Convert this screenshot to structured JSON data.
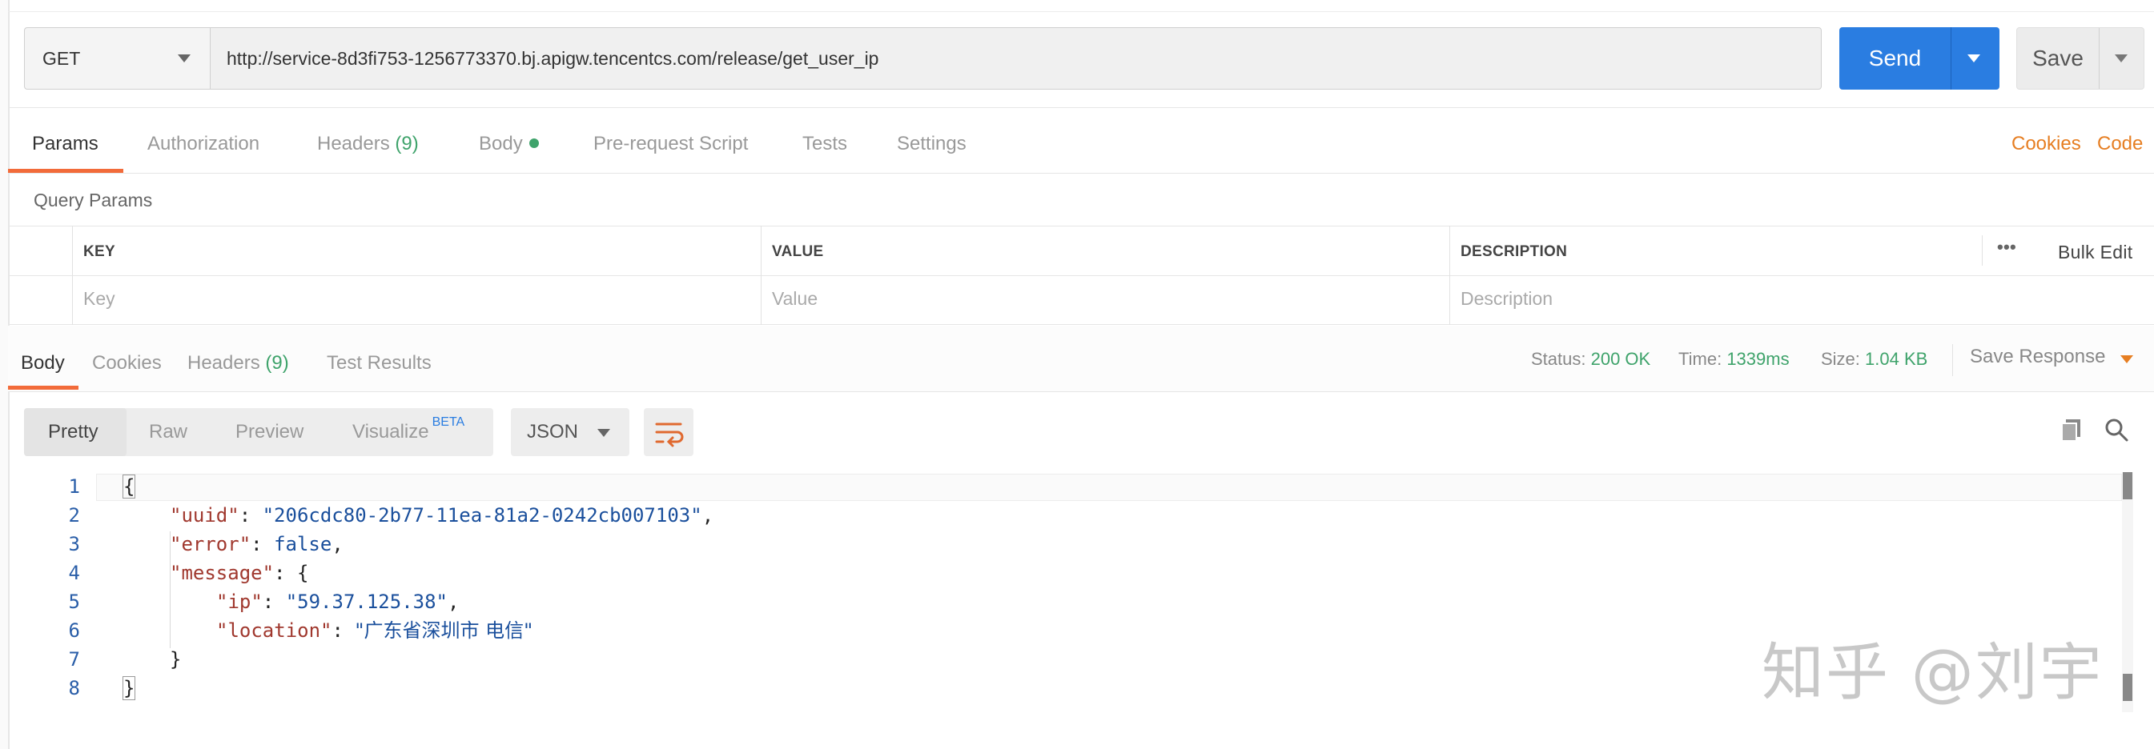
{
  "request": {
    "method": "GET",
    "url": "http://service-8d3fi753-1256773370.bj.apigw.tencentcs.com/release/get_user_ip",
    "send_label": "Send",
    "save_label": "Save"
  },
  "request_tabs": [
    {
      "label": "Params",
      "count": ""
    },
    {
      "label": "Authorization",
      "count": ""
    },
    {
      "label": "Headers",
      "count": "(9)"
    },
    {
      "label": "Body",
      "count": ""
    },
    {
      "label": "Pre-request Script",
      "count": ""
    },
    {
      "label": "Tests",
      "count": ""
    },
    {
      "label": "Settings",
      "count": ""
    }
  ],
  "right_links": {
    "cookies": "Cookies",
    "code": "Code"
  },
  "query_params": {
    "section_label": "Query Params",
    "columns": [
      "KEY",
      "VALUE",
      "DESCRIPTION"
    ],
    "placeholders": [
      "Key",
      "Value",
      "Description"
    ],
    "bulk_edit": "Bulk Edit",
    "more": "•••"
  },
  "response_tabs": [
    {
      "label": "Body",
      "count": ""
    },
    {
      "label": "Cookies",
      "count": ""
    },
    {
      "label": "Headers",
      "count": "(9)"
    },
    {
      "label": "Test Results",
      "count": ""
    }
  ],
  "response_meta": {
    "status_label": "Status:",
    "status_value": "200 OK",
    "time_label": "Time:",
    "time_value": "1339ms",
    "size_label": "Size:",
    "size_value": "1.04 KB",
    "save_response": "Save Response"
  },
  "view_modes": [
    "Pretty",
    "Raw",
    "Preview",
    "Visualize"
  ],
  "beta_badge": "BETA",
  "format": "JSON",
  "code": {
    "line_numbers": [
      "1",
      "2",
      "3",
      "4",
      "5",
      "6",
      "7",
      "8"
    ],
    "line1": "{",
    "uuid_key": "\"uuid\"",
    "uuid_val": "\"206cdc80-2b77-11ea-81a2-0242cb007103\"",
    "error_key": "\"error\"",
    "error_val": "false",
    "message_key": "\"message\"",
    "ip_key": "\"ip\"",
    "ip_val": "\"59.37.125.38\"",
    "location_key": "\"location\"",
    "location_val": "\"广东省深圳市 电信\"",
    "close_inner": "}",
    "close_outer": "}"
  },
  "watermark": "知乎 @刘宇",
  "colors": {
    "accent": "#f26b3a",
    "send": "#2a7de1",
    "ok": "#3fa36b"
  }
}
